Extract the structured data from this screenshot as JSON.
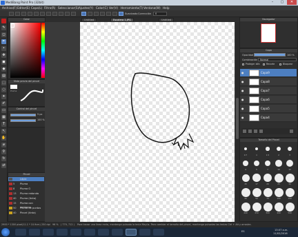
{
  "window": {
    "title": "MediBang Paint Pro (32bit)",
    "min": "–",
    "max": "▢",
    "close": "✕"
  },
  "menu": [
    "Archivo(F)",
    "Editar(E)",
    "Capa(L)",
    "Filtro(R)",
    "Seleccionar(S)",
    "Ajustes(Y)",
    "Color(C)",
    "Ver(V)",
    "Herramienta(T)",
    "Ventana(W)",
    "Help"
  ],
  "toolbar": {
    "smoothing_label": "Suavizado",
    "correction_label": "Corrección",
    "correction_value": "0"
  },
  "tabs": [
    {
      "label": "Untitled",
      "active": false
    },
    {
      "label": "Escalera 1.JPG",
      "active": true
    },
    {
      "label": "Untitled",
      "active": false
    }
  ],
  "color_panel": {
    "title": "Color",
    "fg": "#e00000",
    "bg": "#ffffff"
  },
  "brush_preview": {
    "title": "Vista previa del pincel",
    "label": "Pluma"
  },
  "brush_control": {
    "title": "Control del pincel",
    "size": "5 px",
    "opacity": "100 %"
  },
  "brush_panel": {
    "title": "Pincel",
    "items": [
      {
        "num": "",
        "name": "Lápiz",
        "color": "#555555",
        "selected": true
      },
      {
        "num": "5",
        "name": "Pluma",
        "color": "#b03030",
        "selected": false
      },
      {
        "num": "8",
        "name": "Pluma G",
        "color": "#b03030",
        "selected": false
      },
      {
        "num": "13",
        "name": "Pluma redonda",
        "color": "#b03030",
        "selected": false
      },
      {
        "num": "40",
        "name": "Pluma (tinta)",
        "color": "#b03030",
        "selected": false
      },
      {
        "num": "15",
        "name": "Pluma con contorno",
        "color": "#b03030",
        "selected": false
      },
      {
        "num": "50",
        "name": "Pluma de puntos",
        "color": "#c8a020",
        "selected": false
      },
      {
        "num": "40",
        "name": "Pincel (tinta)",
        "color": "#c8a020",
        "selected": false
      }
    ]
  },
  "navigator": {
    "title": "Navegador"
  },
  "layer_panel": {
    "title": "Capa",
    "opacity_label": "Opacidad",
    "opacity_value": "100 %",
    "blend_label": "Combinación",
    "blend_value": "Normal",
    "protect_label": "Proteger alfa",
    "clip_label": "Recorte",
    "lock_label": "Bloquear",
    "layers": [
      {
        "name": "Capa9",
        "selected": true
      },
      {
        "name": "Capa8",
        "selected": false
      },
      {
        "name": "Capa7",
        "selected": false
      },
      {
        "name": "Capa6",
        "selected": false
      },
      {
        "name": "Capa5",
        "selected": false
      },
      {
        "name": "Capa4",
        "selected": false
      }
    ]
  },
  "brush_size_panel": {
    "title": "Tamaño del Pincel",
    "sizes": [
      "0.7",
      "1",
      "1.5",
      "2",
      "3",
      "4",
      "5",
      "7",
      "10",
      "12",
      "15",
      "17",
      "20",
      "25",
      "30",
      "40",
      "50",
      "70",
      "100",
      "150",
      "200",
      "250",
      "300",
      "400",
      "500"
    ]
  },
  "status": {
    "dims": "2900 * 1300 pixel",
    "zoom": "(11.1 * 10.9cm)",
    "dpi": "250 dpi",
    "percent": "96 %",
    "coords": "( 770, 712 )",
    "hint": "Para trazar una línea recta, mantenga pulsada la tecla Mayús. Para cambiar el tamaño del pincel, mantenga pulsadas las teclas Ctrl + Alt y arrastre."
  },
  "taskbar": {
    "lang": "ES",
    "time": "13:07 a.m.",
    "date": "11/02/2016"
  }
}
